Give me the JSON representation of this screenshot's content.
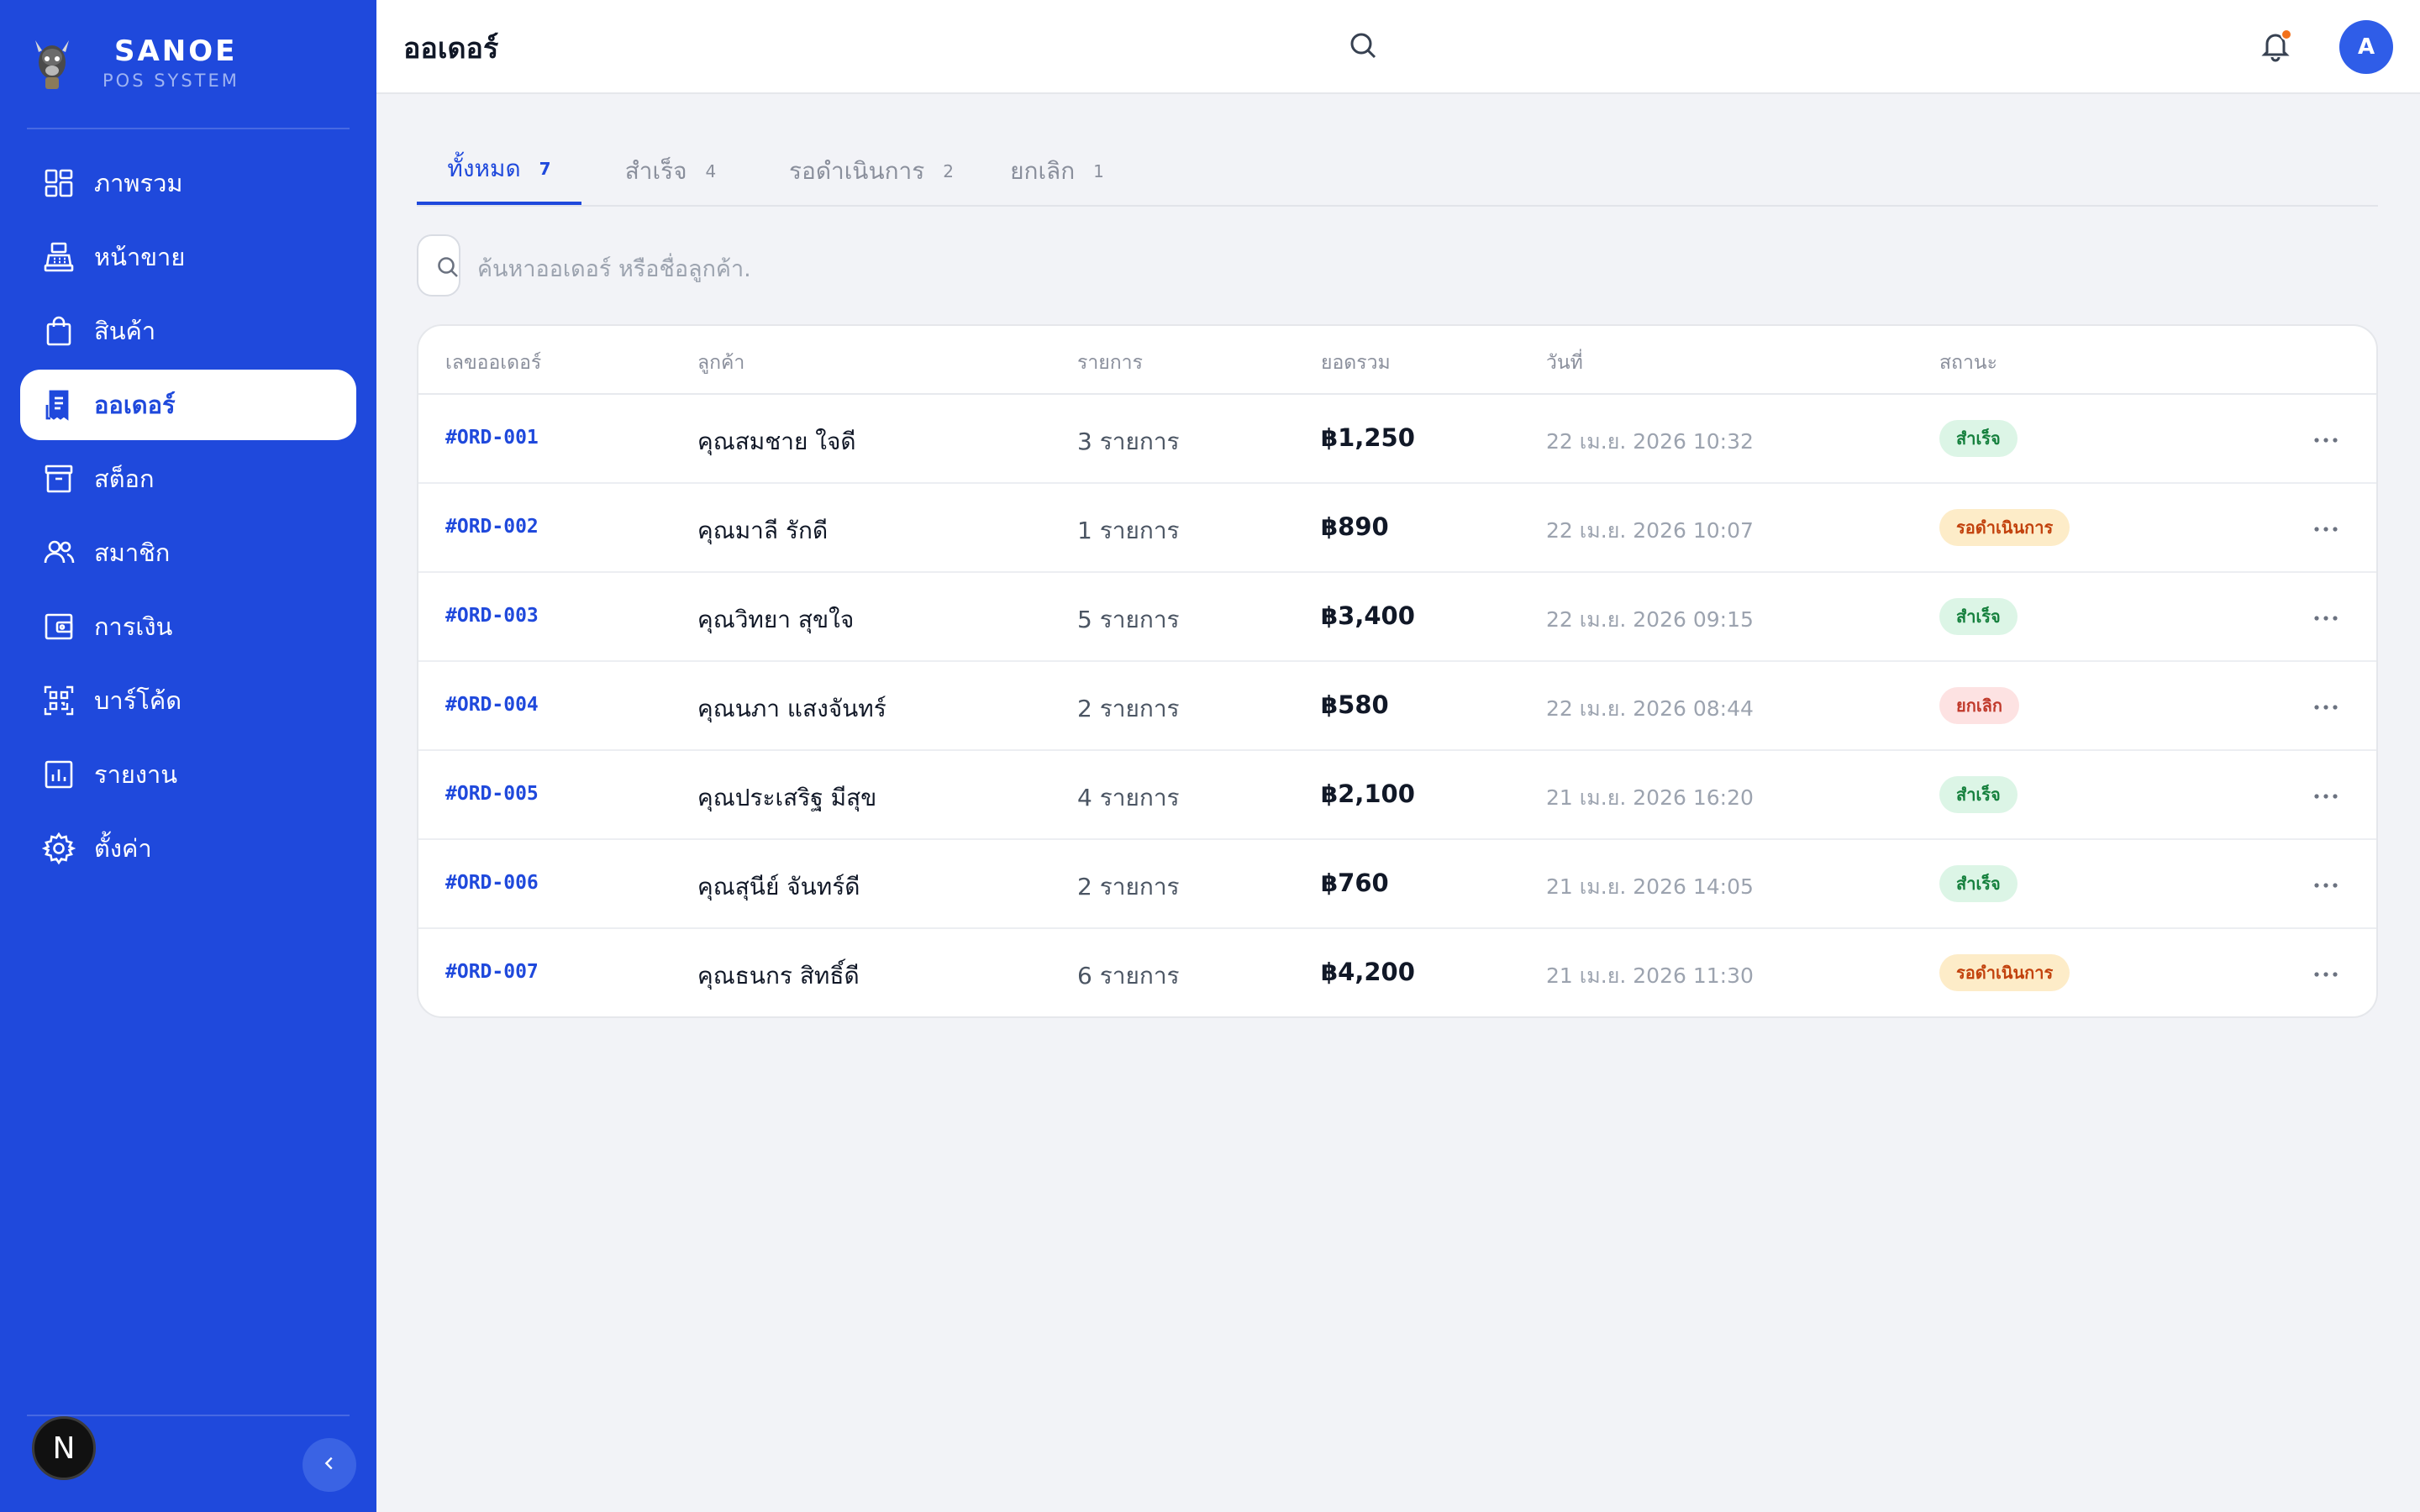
{
  "brand": {
    "name": "SANOE",
    "subtitle": "POS SYSTEM"
  },
  "sidebar": {
    "items": [
      {
        "label": "ภาพรวม",
        "icon": "dashboard-grid-icon",
        "active": false
      },
      {
        "label": "หน้าขาย",
        "icon": "cash-register-icon",
        "active": false
      },
      {
        "label": "สินค้า",
        "icon": "shopping-bag-icon",
        "active": false
      },
      {
        "label": "ออเดอร์",
        "icon": "receipt-icon",
        "active": true
      },
      {
        "label": "สต็อก",
        "icon": "archive-box-icon",
        "active": false
      },
      {
        "label": "สมาชิก",
        "icon": "users-icon",
        "active": false
      },
      {
        "label": "การเงิน",
        "icon": "wallet-icon",
        "active": false
      },
      {
        "label": "บาร์โค้ด",
        "icon": "qr-scan-icon",
        "active": false
      },
      {
        "label": "รายงาน",
        "icon": "bar-chart-icon",
        "active": false
      },
      {
        "label": "ตั้งค่า",
        "icon": "gear-icon",
        "active": false
      }
    ],
    "footer_badge": "N"
  },
  "header": {
    "title": "ออเดอร์",
    "avatar_initial": "A"
  },
  "tabs": [
    {
      "label": "ทั้งหมด",
      "count": "7",
      "active": true
    },
    {
      "label": "สำเร็จ",
      "count": "4",
      "active": false
    },
    {
      "label": "รอดำเนินการ",
      "count": "2",
      "active": false
    },
    {
      "label": "ยกเลิก",
      "count": "1",
      "active": false
    }
  ],
  "search": {
    "placeholder": "ค้นหาออเดอร์ หรือชื่อลูกค้า."
  },
  "table": {
    "headers": [
      "เลขออเดอร์",
      "ลูกค้า",
      "รายการ",
      "ยอดรวม",
      "วันที่",
      "สถานะ"
    ],
    "rows": [
      {
        "id": "#ORD-001",
        "customer": "คุณสมชาย ใจดี",
        "items": "3 รายการ",
        "total": "฿1,250",
        "date": "22 เม.ย. 2026 10:32",
        "status": "สำเร็จ",
        "status_type": "success"
      },
      {
        "id": "#ORD-002",
        "customer": "คุณมาลี รักดี",
        "items": "1 รายการ",
        "total": "฿890",
        "date": "22 เม.ย. 2026 10:07",
        "status": "รอดำเนินการ",
        "status_type": "pending"
      },
      {
        "id": "#ORD-003",
        "customer": "คุณวิทยา สุขใจ",
        "items": "5 รายการ",
        "total": "฿3,400",
        "date": "22 เม.ย. 2026 09:15",
        "status": "สำเร็จ",
        "status_type": "success"
      },
      {
        "id": "#ORD-004",
        "customer": "คุณนภา แสงจันทร์",
        "items": "2 รายการ",
        "total": "฿580",
        "date": "22 เม.ย. 2026 08:44",
        "status": "ยกเลิก",
        "status_type": "cancel"
      },
      {
        "id": "#ORD-005",
        "customer": "คุณประเสริฐ มีสุข",
        "items": "4 รายการ",
        "total": "฿2,100",
        "date": "21 เม.ย. 2026 16:20",
        "status": "สำเร็จ",
        "status_type": "success"
      },
      {
        "id": "#ORD-006",
        "customer": "คุณสุนีย์ จันทร์ดี",
        "items": "2 รายการ",
        "total": "฿760",
        "date": "21 เม.ย. 2026 14:05",
        "status": "สำเร็จ",
        "status_type": "success"
      },
      {
        "id": "#ORD-007",
        "customer": "คุณธนกร สิทธิ์ดี",
        "items": "6 รายการ",
        "total": "฿4,200",
        "date": "21 เม.ย. 2026 11:30",
        "status": "รอดำเนินการ",
        "status_type": "pending"
      }
    ]
  },
  "colors": {
    "sidebar_bg": "#1f49dc",
    "accent": "#1f49dc",
    "success_bg": "#dcf5e6",
    "pending_bg": "#fdecc8",
    "cancel_bg": "#fde2e2",
    "notification_dot": "#f2711c"
  }
}
